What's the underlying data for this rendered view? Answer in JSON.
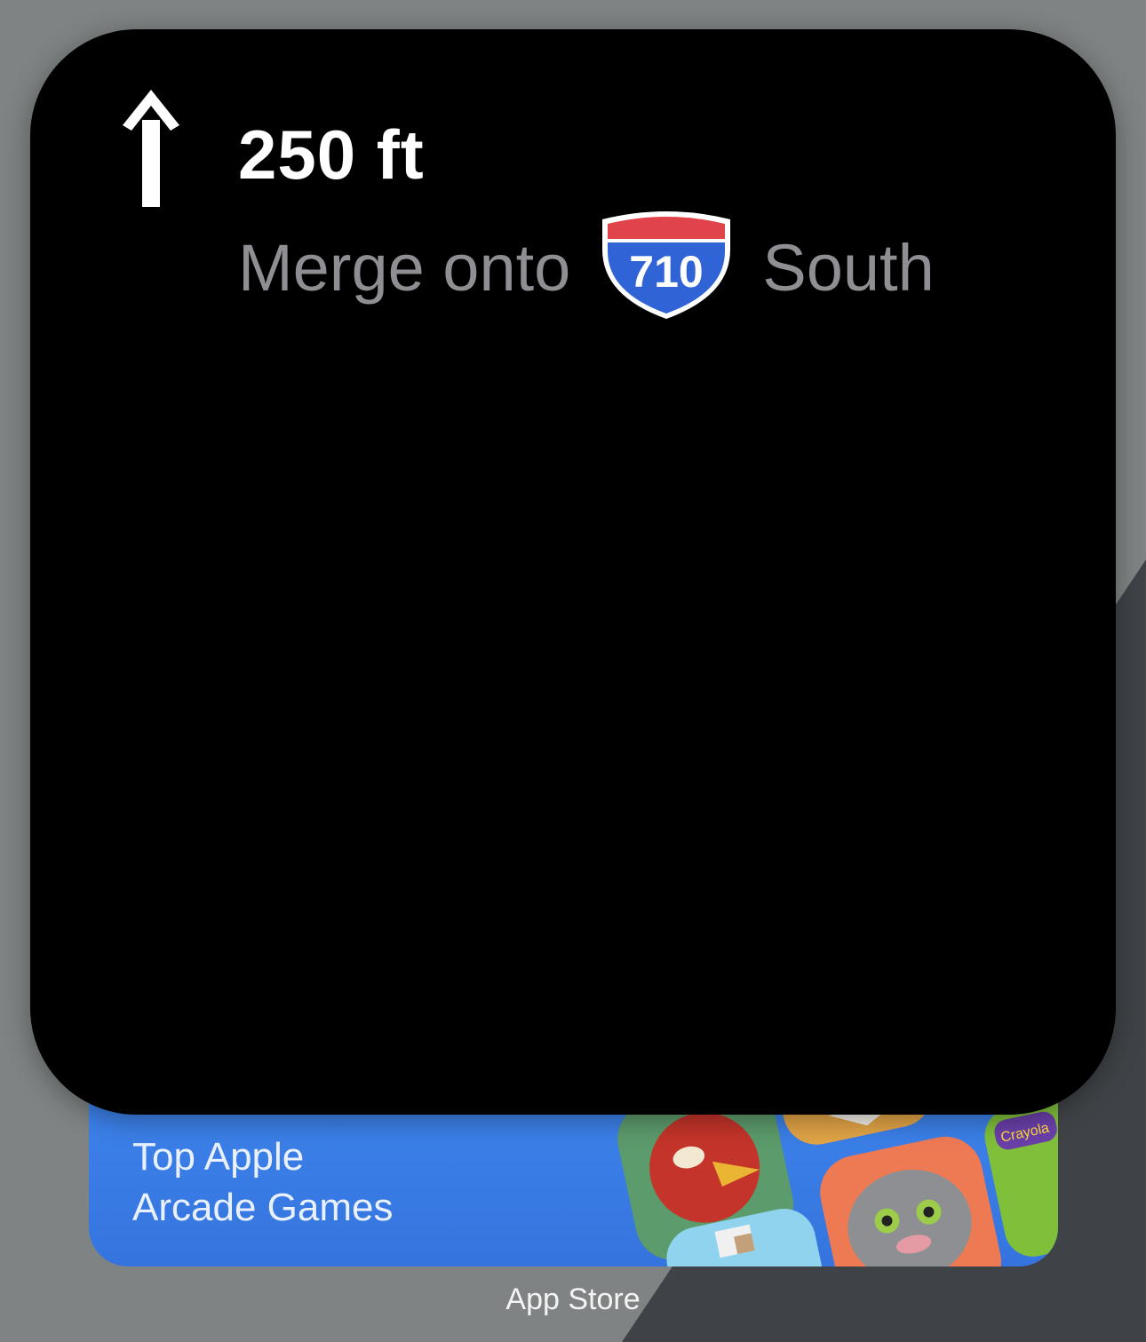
{
  "maps_widget": {
    "maneuver_icon": "straight-arrow-icon",
    "distance": "250 ft",
    "instruction_prefix": "Merge onto",
    "highway_shield": {
      "icon": "interstate-shield-icon",
      "number": "710",
      "colors": {
        "top": "#e53c3c",
        "body": "#2f5fd0",
        "border": "#ffffff"
      }
    },
    "instruction_suffix": "South"
  },
  "app_store_widget": {
    "title": "Top Apple\nArcade Games",
    "caption": "App Store",
    "accent_color": "#3a7de6"
  }
}
